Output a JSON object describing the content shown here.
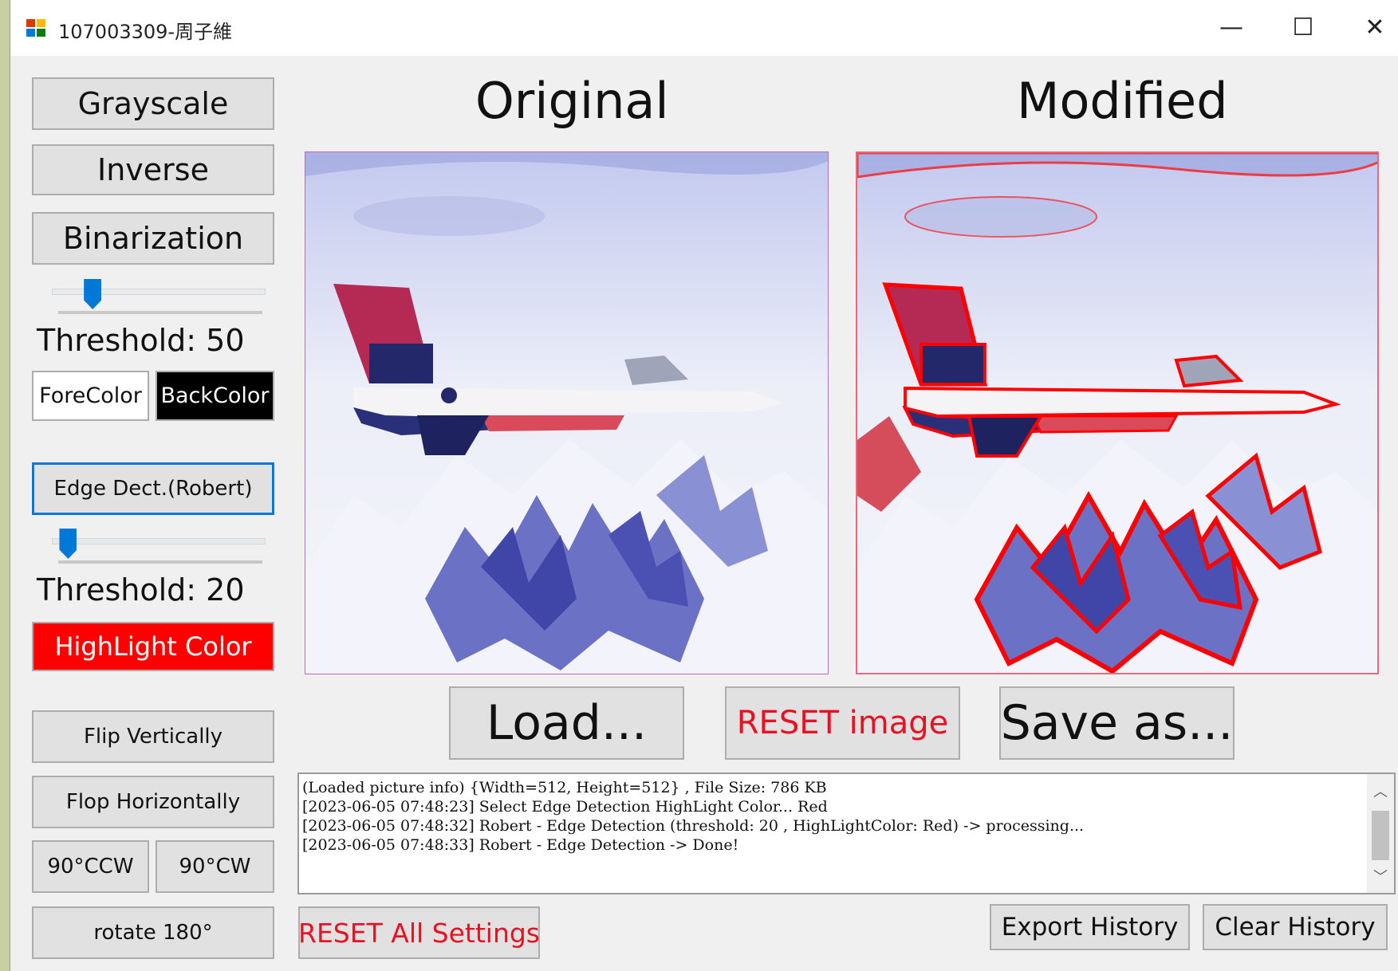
{
  "window": {
    "title": "107003309-周子維",
    "controls": {
      "minimize": "—",
      "maximize": "☐",
      "close": "✕"
    }
  },
  "left_panel": {
    "grayscale_label": "Grayscale",
    "inverse_label": "Inverse",
    "binarization_label": "Binarization",
    "binarization_slider_value": 0.2,
    "binarization_threshold_text": "Threshold: 50",
    "forecolor_label": "ForeColor",
    "backcolor_label": "BackColor",
    "edge_label": "Edge Dect.(Robert)",
    "edge_slider_value": 0.08,
    "edge_threshold_text": "Threshold: 20",
    "highlight_label": "HighLight Color",
    "flip_vertical_label": "Flip Vertically",
    "flop_horizontal_label": "Flop Horizontally",
    "rotate_ccw_label": "90°CCW",
    "rotate_cw_label": "90°CW",
    "rotate_180_label": "rotate 180°"
  },
  "main": {
    "original_title": "Original",
    "modified_title": "Modified",
    "load_label": "Load...",
    "reset_image_label": "RESET image",
    "save_as_label": "Save as...",
    "reset_all_label": "RESET All Settings",
    "export_history_label": "Export History",
    "clear_history_label": "Clear History"
  },
  "log": {
    "lines": [
      "(Loaded picture info) {Width=512, Height=512} , File Size: 786 KB",
      "[2023-06-05 07:48:23] Select Edge Detection HighLight Color... Red",
      "[2023-06-05 07:48:32] Robert - Edge Detection (threshold: 20 , HighLightColor: Red) -> processing...",
      "[2023-06-05 07:48:33] Robert - Edge Detection -> Done!"
    ]
  },
  "colors": {
    "accent": "#0078d7",
    "highlight": "#ff0000",
    "reset_text": "#e81123",
    "forecolor_bg": "#ffffff",
    "backcolor_bg": "#000000"
  },
  "images": {
    "original": "F-16 jet over snowy mountains",
    "modified": "F-16 jet with red edge highlights"
  }
}
